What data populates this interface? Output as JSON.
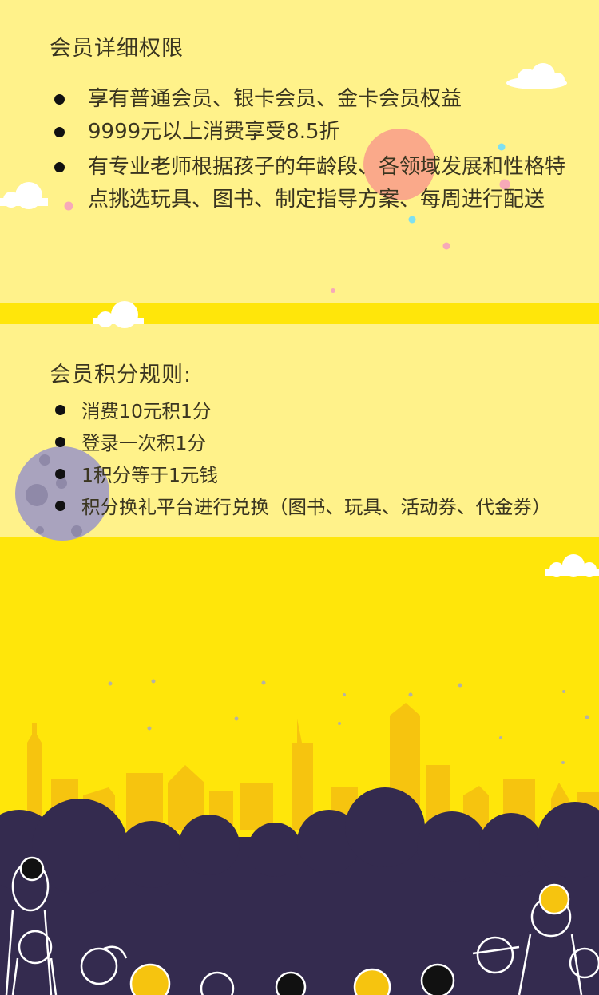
{
  "section1": {
    "title": "会员详细权限",
    "items": [
      "享有普通会员、银卡会员、金卡会员权益",
      "9999元以上消费享受8.5折",
      "有专业老师根据孩子的年龄段、各领域发展和性格特点挑选玩具、图书、制定指导方案、每周进行配送"
    ]
  },
  "section2": {
    "title": "会员积分规则:",
    "items": [
      "消费10元积1分",
      "登录一次积1分",
      "1积分等于1元钱",
      "积分换礼平台进行兑换（图书、玩具、活动券、代金券）"
    ]
  },
  "colors": {
    "panel": "#fff28a",
    "background": "#ffe60a",
    "buildings": "#f6c40f",
    "hills": "#342b4f",
    "sun": "#f9a18a",
    "moon": "#a9a3be"
  }
}
